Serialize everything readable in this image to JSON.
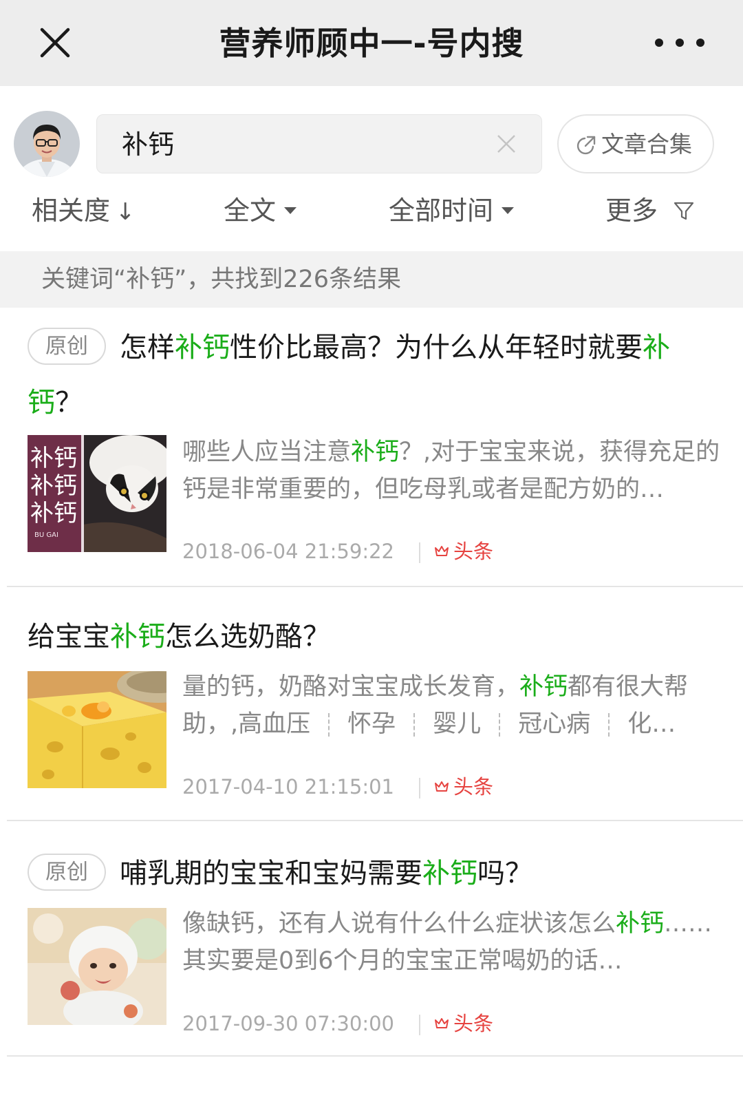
{
  "navbar": {
    "title": "营养师顾中一-号内搜"
  },
  "search": {
    "query": "补钙",
    "collection_label": "文章合集"
  },
  "filters": [
    {
      "label": "相关度",
      "indicator": "↓"
    },
    {
      "label": "全文",
      "indicator": "caret"
    },
    {
      "label": "全部时间",
      "indicator": "caret"
    },
    {
      "label": "更多",
      "indicator": "filter"
    }
  ],
  "summary": {
    "text": "关键词“补钙”，共找到226条结果"
  },
  "results": [
    {
      "tag": "原创",
      "title_parts": [
        {
          "text": "怎样"
        },
        {
          "text": "补钙",
          "highlight": true
        },
        {
          "text": "性价比最高？为什么从年轻时就要"
        },
        {
          "text": "补钙",
          "highlight": true
        },
        {
          "text": "？"
        }
      ],
      "thumbnail": {
        "label_lines": [
          "补钙",
          "补钙",
          "补钙"
        ],
        "sub": "BU  GAI",
        "theme": "cat"
      },
      "snippet_parts": [
        {
          "text": "哪些人应当注意"
        },
        {
          "text": "补钙",
          "highlight": true
        },
        {
          "text": "？,对于宝宝来说，获得充足的钙是非常重要的，但吃母乳或者是配方奶的…"
        }
      ],
      "date": "2018-06-04 21:59:22",
      "badge": "头条"
    },
    {
      "tag": "",
      "title_parts": [
        {
          "text": "给宝宝"
        },
        {
          "text": "补钙",
          "highlight": true
        },
        {
          "text": "怎么选奶酪？"
        }
      ],
      "thumbnail": {
        "theme": "cheese"
      },
      "snippet_parts": [
        {
          "text": "量的钙，奶酪对宝宝成长发育，"
        },
        {
          "text": "补钙",
          "highlight": true
        },
        {
          "text": "都有很大帮助，,高血压"
        },
        {
          "sep": true
        },
        {
          "text": "怀孕"
        },
        {
          "sep": true
        },
        {
          "text": "婴儿"
        },
        {
          "sep": true
        },
        {
          "text": "冠心病"
        },
        {
          "sep": true
        },
        {
          "text": "化…"
        }
      ],
      "date": "2017-04-10 21:15:01",
      "badge": "头条"
    },
    {
      "tag": "原创",
      "title_parts": [
        {
          "text": "哺乳期的宝宝和宝妈需要"
        },
        {
          "text": "补钙",
          "highlight": true
        },
        {
          "text": "吗？"
        }
      ],
      "thumbnail": {
        "theme": "baby"
      },
      "snippet_parts": [
        {
          "text": "像缺钙，还有人说有什么什么症状该怎么"
        },
        {
          "text": "补钙",
          "highlight": true
        },
        {
          "text": "……其实要是0到6个月的宝宝正常喝奶的话…"
        }
      ],
      "date": "2017-09-30 07:30:00",
      "badge": "头条"
    }
  ]
}
